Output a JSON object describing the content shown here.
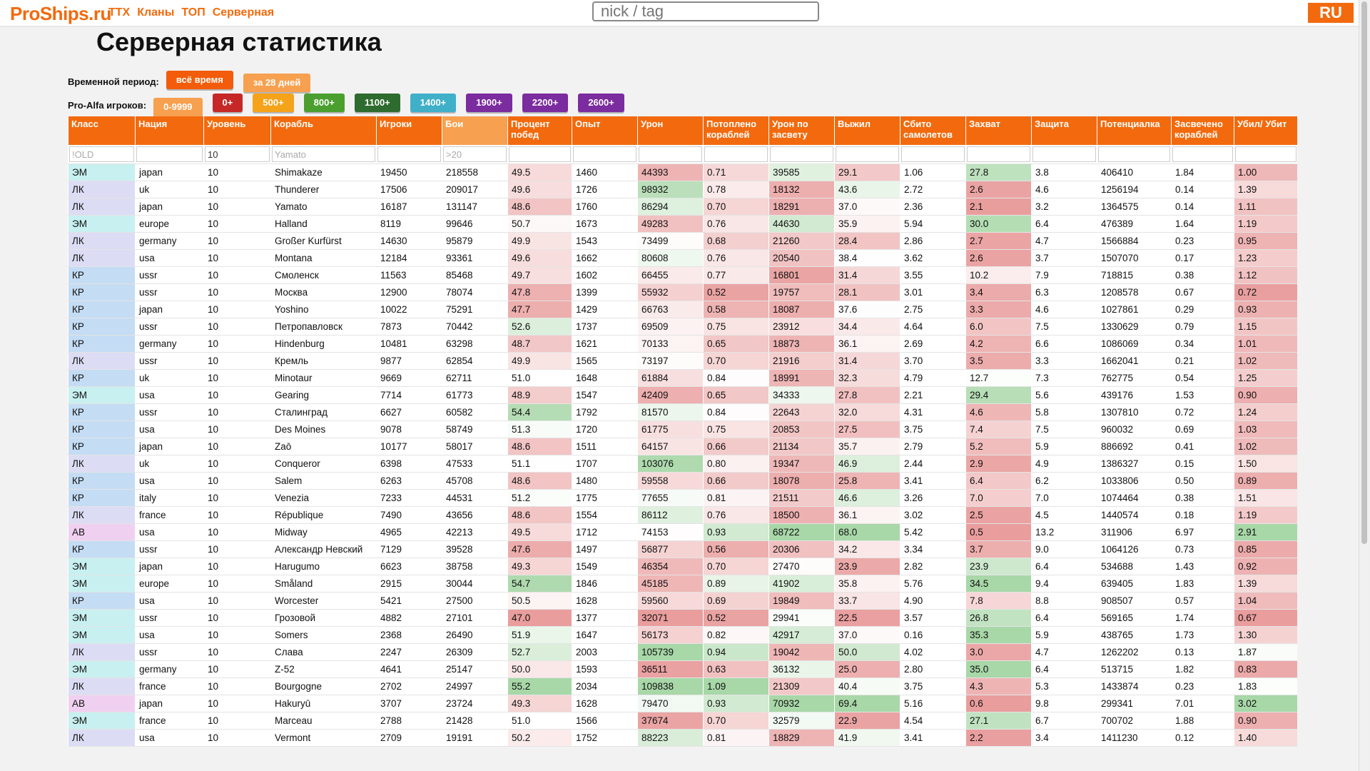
{
  "header": {
    "logo": "ProShips.ru",
    "nav": [
      "ТТХ",
      "Кланы",
      "ТОП",
      "Серверная"
    ],
    "search_placeholder": "nick / tag",
    "lang": "RU"
  },
  "page_title": "Серверная статистика",
  "period": {
    "label": "Временной период:",
    "buttons": [
      {
        "label": "всё время",
        "color": "#f25c0a"
      },
      {
        "label": "за 28 дней",
        "color": "#f7a04f"
      }
    ]
  },
  "pro_alfa": {
    "label": "Pro-Alfa игроков:",
    "buttons": [
      {
        "label": "0-9999",
        "color": "#f7a04f"
      },
      {
        "label": "0+",
        "color": "#c62828"
      },
      {
        "label": "500+",
        "color": "#f5a31a"
      },
      {
        "label": "800+",
        "color": "#4a9f2e"
      },
      {
        "label": "1100+",
        "color": "#2e6b2f"
      },
      {
        "label": "1400+",
        "color": "#3fb0c8"
      },
      {
        "label": "1900+",
        "color": "#7b2c9e"
      },
      {
        "label": "2200+",
        "color": "#7b2c9e"
      },
      {
        "label": "2600+",
        "color": "#7b2c9e"
      }
    ]
  },
  "table": {
    "columns": [
      "Класс",
      "Нация",
      "Уровень",
      "Корабль",
      "Игроки",
      "Бои",
      "Процент побед",
      "Опыт",
      "Урон",
      "Потоплено кораблей",
      "Урон по засвету",
      "Выжил",
      "Сбито самолетов",
      "Захват",
      "Защита",
      "Потенциалка",
      "Засвечено кораблей",
      "Убил/ Убит"
    ],
    "filters": [
      "!OLD",
      "",
      "10",
      "Yamato",
      "",
      ">20",
      "",
      "",
      "",
      "",
      "",
      "",
      "",
      "",
      "",
      "",
      "",
      ""
    ],
    "rows": [
      [
        "ЭМ",
        "japan",
        "10",
        "Shimakaze",
        "19450",
        "218558",
        "49.5",
        "1460",
        "44393",
        "0.71",
        "39585",
        "29.1",
        "1.06",
        "27.8",
        "3.8",
        "406410",
        "1.84",
        "1.00"
      ],
      [
        "ЛК",
        "uk",
        "10",
        "Thunderer",
        "17506",
        "209017",
        "49.6",
        "1726",
        "98932",
        "0.78",
        "18132",
        "43.6",
        "2.72",
        "2.6",
        "4.6",
        "1256194",
        "0.14",
        "1.39"
      ],
      [
        "ЛК",
        "japan",
        "10",
        "Yamato",
        "16187",
        "131147",
        "48.6",
        "1760",
        "86294",
        "0.70",
        "18291",
        "37.0",
        "2.36",
        "2.1",
        "3.2",
        "1364575",
        "0.14",
        "1.11"
      ],
      [
        "ЭМ",
        "europe",
        "10",
        "Halland",
        "8119",
        "99646",
        "50.7",
        "1673",
        "49283",
        "0.76",
        "44630",
        "35.9",
        "5.94",
        "30.0",
        "6.4",
        "476389",
        "1.64",
        "1.19"
      ],
      [
        "ЛК",
        "germany",
        "10",
        "Großer Kurfürst",
        "14630",
        "95879",
        "49.9",
        "1543",
        "73499",
        "0.68",
        "21260",
        "28.4",
        "2.86",
        "2.7",
        "4.7",
        "1566884",
        "0.23",
        "0.95"
      ],
      [
        "ЛК",
        "usa",
        "10",
        "Montana",
        "12184",
        "93361",
        "49.6",
        "1662",
        "80608",
        "0.76",
        "20540",
        "38.4",
        "3.62",
        "2.6",
        "3.7",
        "1507070",
        "0.17",
        "1.23"
      ],
      [
        "КР",
        "ussr",
        "10",
        "Смоленск",
        "11563",
        "85468",
        "49.7",
        "1602",
        "66455",
        "0.77",
        "16801",
        "31.4",
        "3.55",
        "10.2",
        "7.9",
        "718815",
        "0.38",
        "1.12"
      ],
      [
        "КР",
        "ussr",
        "10",
        "Москва",
        "12900",
        "78074",
        "47.8",
        "1399",
        "55932",
        "0.52",
        "19757",
        "28.1",
        "3.01",
        "3.4",
        "6.3",
        "1208578",
        "0.67",
        "0.72"
      ],
      [
        "КР",
        "japan",
        "10",
        "Yoshino",
        "10022",
        "75291",
        "47.7",
        "1429",
        "66763",
        "0.58",
        "18087",
        "37.6",
        "2.75",
        "3.3",
        "4.6",
        "1027861",
        "0.29",
        "0.93"
      ],
      [
        "КР",
        "ussr",
        "10",
        "Петропавловск",
        "7873",
        "70442",
        "52.6",
        "1737",
        "69509",
        "0.75",
        "23912",
        "34.4",
        "4.64",
        "6.0",
        "7.5",
        "1330629",
        "0.79",
        "1.15"
      ],
      [
        "КР",
        "germany",
        "10",
        "Hindenburg",
        "10481",
        "63298",
        "48.7",
        "1621",
        "70133",
        "0.65",
        "18873",
        "36.1",
        "2.69",
        "4.2",
        "6.6",
        "1086069",
        "0.34",
        "1.01"
      ],
      [
        "ЛК",
        "ussr",
        "10",
        "Кремль",
        "9877",
        "62854",
        "49.9",
        "1565",
        "73197",
        "0.70",
        "21916",
        "31.4",
        "3.70",
        "3.5",
        "3.3",
        "1662041",
        "0.21",
        "1.02"
      ],
      [
        "КР",
        "uk",
        "10",
        "Minotaur",
        "9669",
        "62711",
        "51.0",
        "1648",
        "61884",
        "0.84",
        "18991",
        "32.3",
        "4.79",
        "12.7",
        "7.3",
        "762775",
        "0.54",
        "1.25"
      ],
      [
        "ЭМ",
        "usa",
        "10",
        "Gearing",
        "7714",
        "61773",
        "48.9",
        "1547",
        "42409",
        "0.65",
        "34333",
        "27.8",
        "2.21",
        "29.4",
        "5.6",
        "439176",
        "1.53",
        "0.90"
      ],
      [
        "КР",
        "ussr",
        "10",
        "Сталинград",
        "6627",
        "60582",
        "54.4",
        "1792",
        "81570",
        "0.84",
        "22643",
        "32.0",
        "4.31",
        "4.6",
        "5.8",
        "1307810",
        "0.72",
        "1.24"
      ],
      [
        "КР",
        "usa",
        "10",
        "Des Moines",
        "9078",
        "58749",
        "51.3",
        "1720",
        "61775",
        "0.75",
        "20853",
        "27.5",
        "3.75",
        "7.4",
        "7.5",
        "960032",
        "0.69",
        "1.03"
      ],
      [
        "КР",
        "japan",
        "10",
        "Zaō",
        "10177",
        "58017",
        "48.6",
        "1511",
        "64157",
        "0.66",
        "21134",
        "35.7",
        "2.79",
        "5.2",
        "5.9",
        "886692",
        "0.41",
        "1.02"
      ],
      [
        "ЛК",
        "uk",
        "10",
        "Conqueror",
        "6398",
        "47533",
        "51.1",
        "1707",
        "103076",
        "0.80",
        "19347",
        "46.9",
        "2.44",
        "2.9",
        "4.9",
        "1386327",
        "0.15",
        "1.50"
      ],
      [
        "КР",
        "usa",
        "10",
        "Salem",
        "6263",
        "45708",
        "48.6",
        "1480",
        "59558",
        "0.66",
        "18078",
        "25.8",
        "3.41",
        "6.4",
        "6.2",
        "1033806",
        "0.50",
        "0.89"
      ],
      [
        "КР",
        "italy",
        "10",
        "Venezia",
        "7233",
        "44531",
        "51.2",
        "1775",
        "77655",
        "0.81",
        "21511",
        "46.6",
        "3.26",
        "7.0",
        "7.0",
        "1074464",
        "0.38",
        "1.51"
      ],
      [
        "ЛК",
        "france",
        "10",
        "République",
        "7490",
        "43656",
        "48.6",
        "1554",
        "86112",
        "0.76",
        "18500",
        "36.1",
        "3.02",
        "2.5",
        "4.5",
        "1440574",
        "0.18",
        "1.19"
      ],
      [
        "АВ",
        "usa",
        "10",
        "Midway",
        "4965",
        "42213",
        "49.5",
        "1712",
        "74153",
        "0.93",
        "68722",
        "68.0",
        "5.42",
        "0.5",
        "13.2",
        "311906",
        "6.97",
        "2.91"
      ],
      [
        "КР",
        "ussr",
        "10",
        "Александр Невский",
        "7129",
        "39528",
        "47.6",
        "1497",
        "56877",
        "0.56",
        "20306",
        "34.2",
        "3.34",
        "3.7",
        "9.0",
        "1064126",
        "0.73",
        "0.85"
      ],
      [
        "ЭМ",
        "japan",
        "10",
        "Harugumo",
        "6623",
        "38758",
        "49.3",
        "1549",
        "46354",
        "0.70",
        "27470",
        "23.9",
        "2.82",
        "23.9",
        "6.4",
        "534688",
        "1.43",
        "0.92"
      ],
      [
        "ЭМ",
        "europe",
        "10",
        "Småland",
        "2915",
        "30044",
        "54.7",
        "1846",
        "45185",
        "0.89",
        "41902",
        "35.8",
        "5.76",
        "34.5",
        "9.4",
        "639405",
        "1.83",
        "1.39"
      ],
      [
        "КР",
        "usa",
        "10",
        "Worcester",
        "5421",
        "27500",
        "50.5",
        "1628",
        "59560",
        "0.69",
        "19849",
        "33.7",
        "4.90",
        "7.8",
        "8.8",
        "908507",
        "0.57",
        "1.04"
      ],
      [
        "ЭМ",
        "ussr",
        "10",
        "Грозовой",
        "4882",
        "27101",
        "47.0",
        "1377",
        "32071",
        "0.52",
        "29941",
        "22.5",
        "3.57",
        "26.8",
        "6.4",
        "569165",
        "1.74",
        "0.67"
      ],
      [
        "ЭМ",
        "usa",
        "10",
        "Somers",
        "2368",
        "26490",
        "51.9",
        "1647",
        "56173",
        "0.82",
        "42917",
        "37.0",
        "0.16",
        "35.3",
        "5.9",
        "438765",
        "1.73",
        "1.30"
      ],
      [
        "ЛК",
        "ussr",
        "10",
        "Слава",
        "2247",
        "26309",
        "52.7",
        "2003",
        "105739",
        "0.94",
        "19042",
        "50.0",
        "4.02",
        "3.0",
        "4.7",
        "1262202",
        "0.13",
        "1.87"
      ],
      [
        "ЭМ",
        "germany",
        "10",
        "Z-52",
        "4641",
        "25147",
        "50.0",
        "1593",
        "36511",
        "0.63",
        "36132",
        "25.0",
        "2.80",
        "35.0",
        "6.4",
        "513715",
        "1.82",
        "0.83"
      ],
      [
        "ЛК",
        "france",
        "10",
        "Bourgogne",
        "2702",
        "24997",
        "55.2",
        "2034",
        "109838",
        "1.09",
        "21309",
        "40.4",
        "3.75",
        "4.3",
        "5.3",
        "1433874",
        "0.23",
        "1.83"
      ],
      [
        "АВ",
        "japan",
        "10",
        "Hakuryū",
        "3707",
        "23724",
        "49.3",
        "1628",
        "79470",
        "0.93",
        "70932",
        "69.4",
        "5.16",
        "0.6",
        "9.8",
        "299341",
        "7.01",
        "3.02"
      ],
      [
        "ЭМ",
        "france",
        "10",
        "Marceau",
        "2788",
        "21428",
        "51.0",
        "1566",
        "37674",
        "0.70",
        "32579",
        "22.9",
        "4.54",
        "27.1",
        "6.7",
        "700702",
        "1.88",
        "0.90"
      ],
      [
        "ЛК",
        "usa",
        "10",
        "Vermont",
        "2709",
        "19191",
        "50.2",
        "1752",
        "88223",
        "0.81",
        "18829",
        "41.9",
        "3.41",
        "2.2",
        "3.4",
        "1411230",
        "0.12",
        "1.40"
      ]
    ]
  }
}
